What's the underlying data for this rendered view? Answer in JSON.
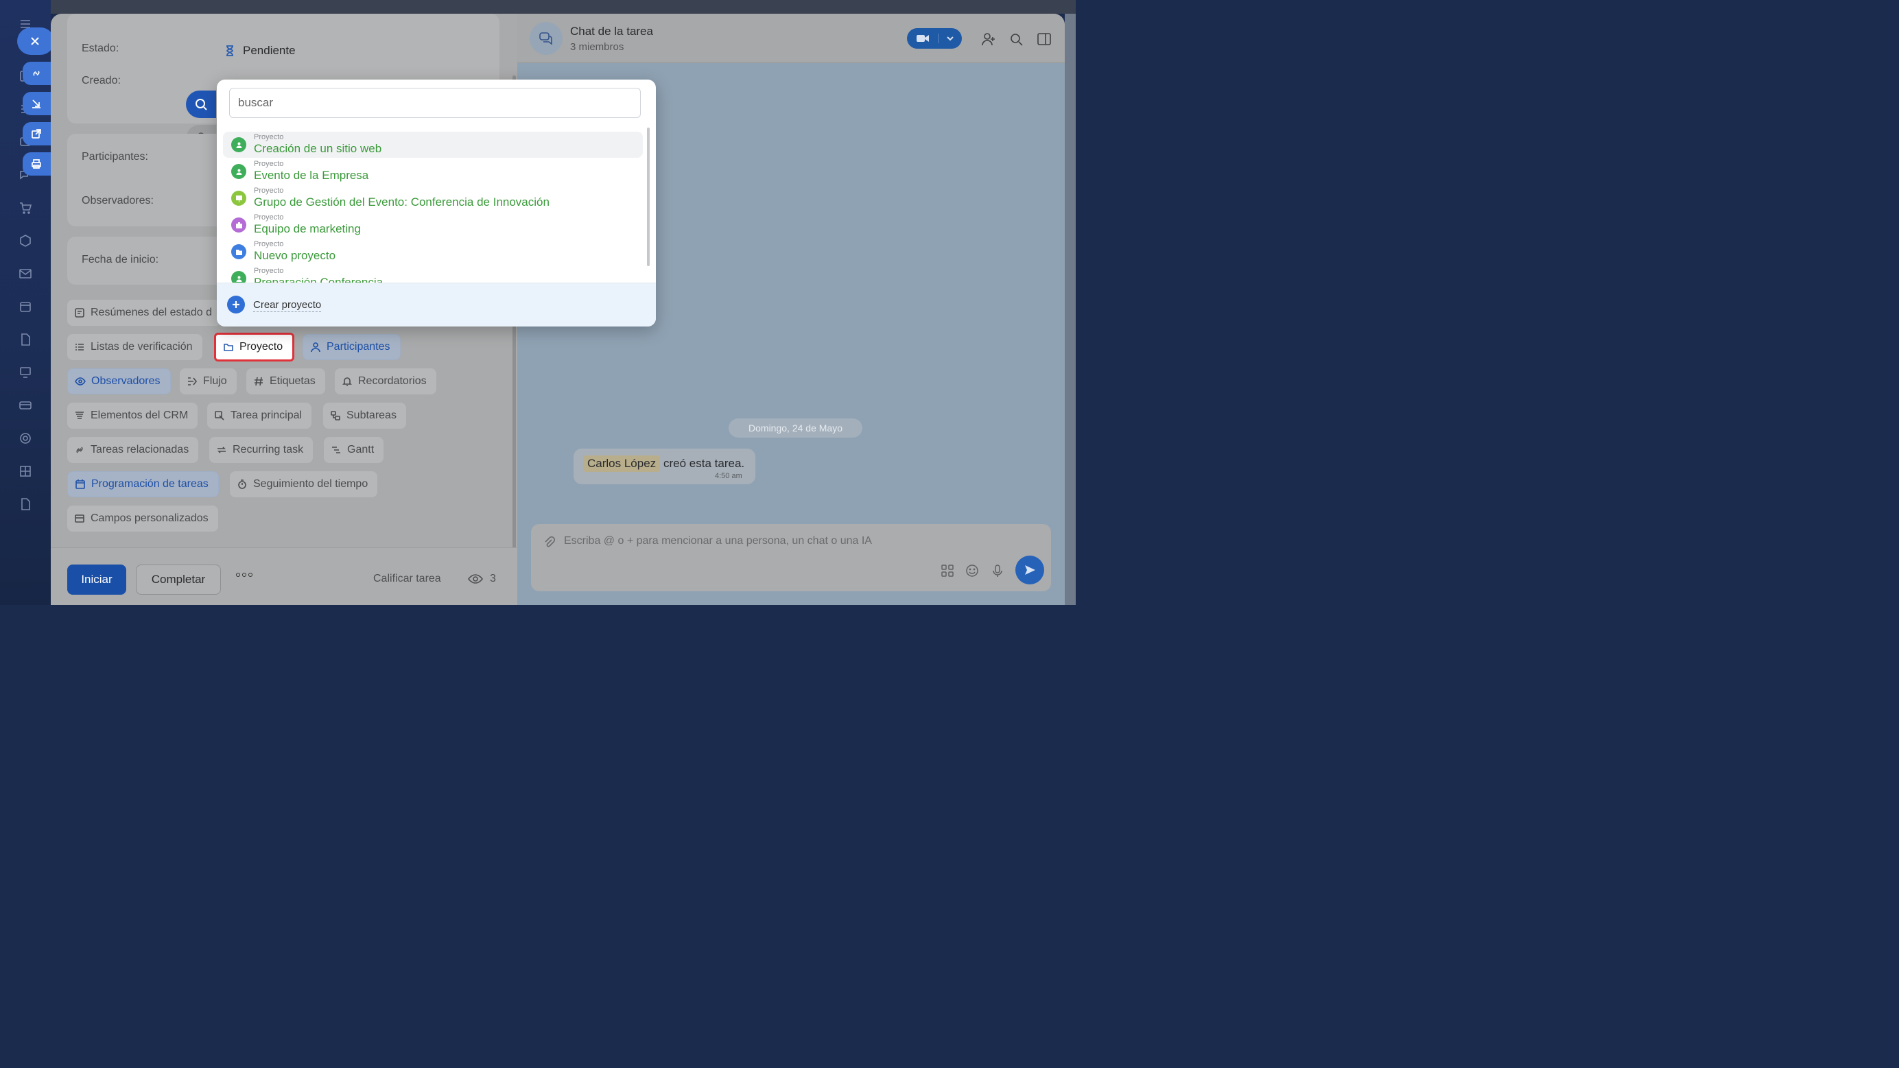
{
  "task": {
    "status_label": "Estado:",
    "status_value": "Pendiente",
    "created_label": "Creado:",
    "participants_label": "Participantes:",
    "observers_label": "Observadores:",
    "start_date_label": "Fecha de inicio:"
  },
  "chips": {
    "status_summaries": "Resúmenes del estado d",
    "checklists": "Listas de verificación",
    "project": "Proyecto",
    "participants": "Participantes",
    "observers": "Observadores",
    "flow": "Flujo",
    "tags": "Etiquetas",
    "reminders": "Recordatorios",
    "crm_items": "Elementos del CRM",
    "parent_task": "Tarea principal",
    "subtasks": "Subtareas",
    "related_tasks": "Tareas relacionadas",
    "recurring_task": "Recurring task",
    "gantt": "Gantt",
    "task_scheduling": "Programación de tareas",
    "time_tracking": "Seguimiento del tiempo",
    "custom_fields": "Campos personalizados"
  },
  "actions": {
    "start": "Iniciar",
    "complete": "Completar",
    "rate": "Calificar tarea",
    "views_count": "3"
  },
  "chat": {
    "title": "Chat de la tarea",
    "members": "3 miembros",
    "date_separator": "Domingo, 24 de Mayo",
    "message_user": "Carlos López",
    "message_text": "creó esta tarea.",
    "message_time": "4:50 am",
    "composer_placeholder": "Escriba @ o + para mencionar a una persona, un chat o una IA"
  },
  "popup": {
    "search_placeholder": "buscar",
    "items": [
      {
        "kind": "Proyecto",
        "name": "Creación de un sitio web",
        "icon": "group-icon",
        "color": "#3fae5a"
      },
      {
        "kind": "Proyecto",
        "name": "Evento de la Empresa",
        "icon": "group-icon",
        "color": "#3fae5a"
      },
      {
        "kind": "Proyecto",
        "name": "Grupo de Gestión del Evento: Conferencia de Innovación",
        "icon": "presentation-icon",
        "color": "#8cc63f"
      },
      {
        "kind": "Proyecto",
        "name": "Equipo de marketing",
        "icon": "briefcase-icon",
        "color": "#b46bd6"
      },
      {
        "kind": "Proyecto",
        "name": "Nuevo proyecto",
        "icon": "folder-icon",
        "color": "#3d7ee0"
      },
      {
        "kind": "Proyecto",
        "name": "Preparación Conferencia",
        "icon": "group-icon",
        "color": "#3fae5a"
      }
    ],
    "create_label": "Crear proyecto"
  }
}
